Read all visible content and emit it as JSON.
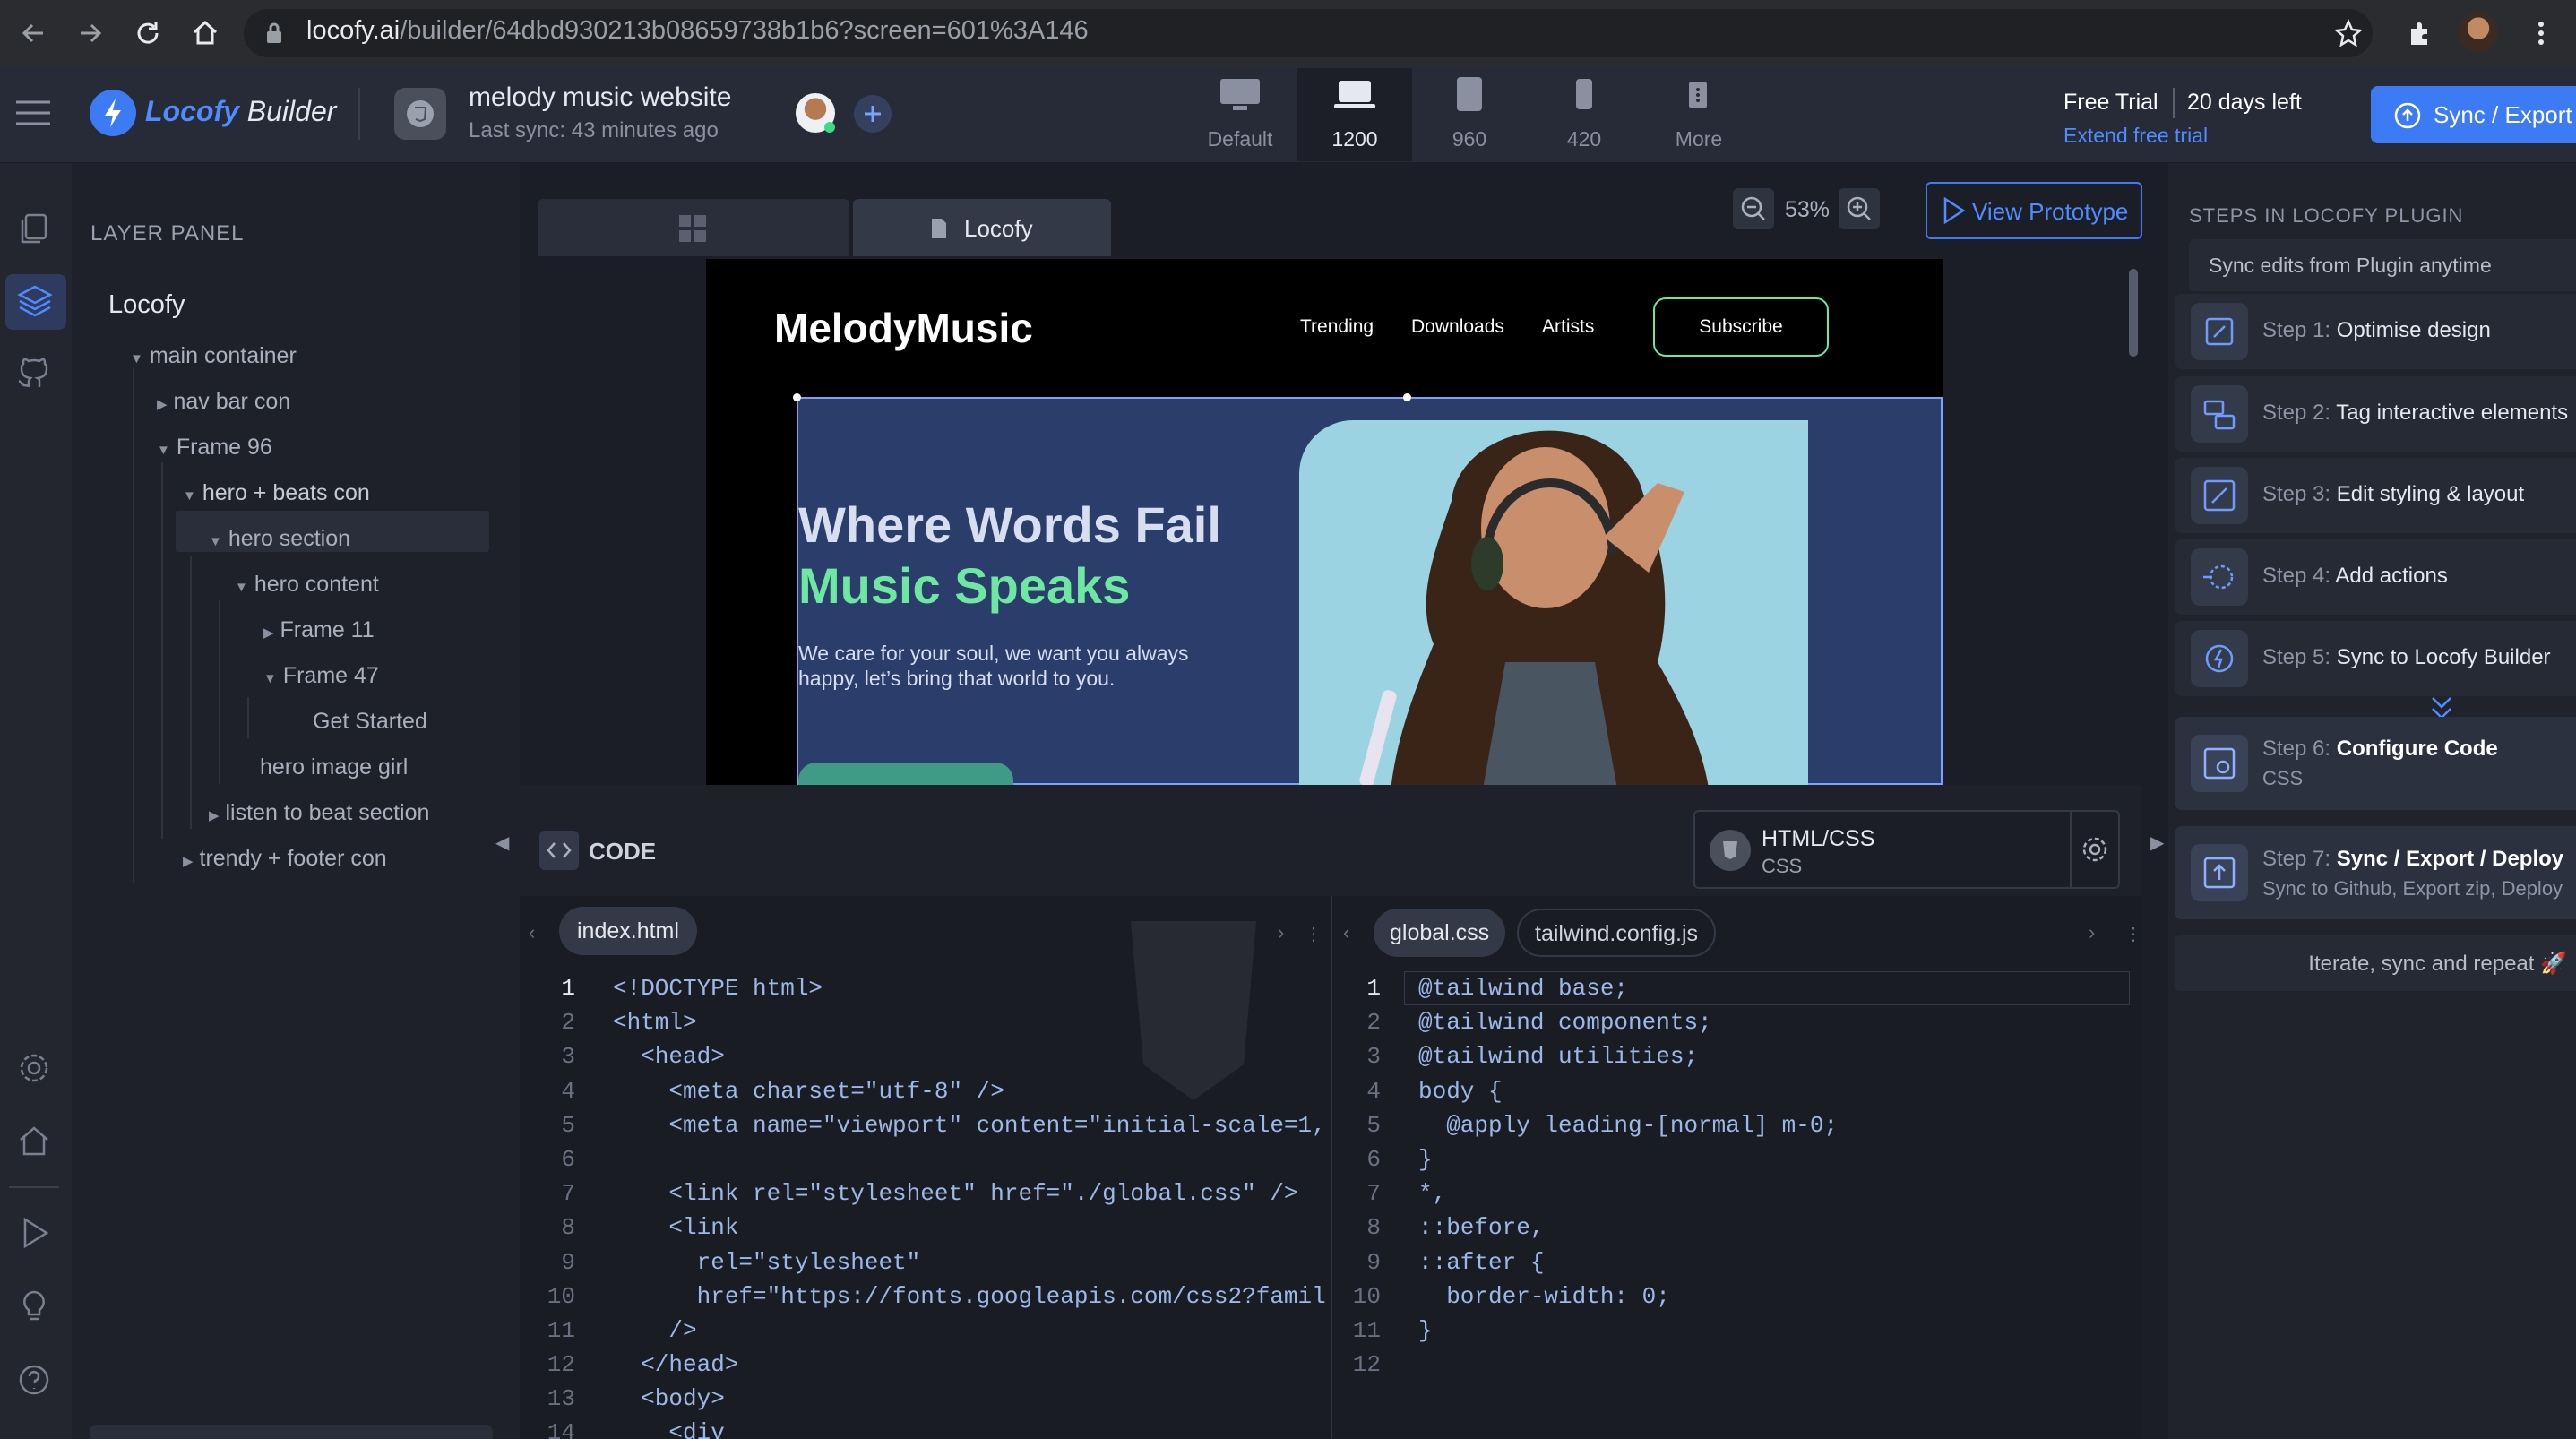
{
  "browser": {
    "url_host": "locofy.ai",
    "url_path": "/builder/64dbd930213b08659738b1b6?screen=601%3A146"
  },
  "header": {
    "brand": "Locofy",
    "brand_suffix": "Builder",
    "project_name": "melody music website",
    "last_sync": "Last sync: 43 minutes ago",
    "breakpoints": [
      {
        "label": "Default"
      },
      {
        "label": "1200"
      },
      {
        "label": "960"
      },
      {
        "label": "420"
      },
      {
        "label": "More"
      }
    ],
    "active_breakpoint": "1200",
    "trial_label": "Free Trial",
    "trial_days": "20 days left",
    "extend_link": "Extend free trial",
    "sync_button": "Sync / Export"
  },
  "layer_panel": {
    "title": "LAYER PANEL",
    "root": "Locofy",
    "items": [
      {
        "label": "main container"
      },
      {
        "label": "nav bar con"
      },
      {
        "label": "Frame 96"
      },
      {
        "label": "hero + beats con"
      },
      {
        "label": "hero section"
      },
      {
        "label": "hero content"
      },
      {
        "label": "Frame 11"
      },
      {
        "label": "Frame 47"
      },
      {
        "label": "Get Started"
      },
      {
        "label": "hero image girl"
      },
      {
        "label": "listen to beat section"
      },
      {
        "label": "trendy + footer con"
      }
    ]
  },
  "canvas": {
    "tab_label": "Locofy",
    "zoom": "53%",
    "view_prototype": "View Prototype",
    "preview": {
      "logo": "MelodyMusic",
      "nav": [
        "Trending",
        "Downloads",
        "Artists"
      ],
      "subscribe": "Subscribe",
      "headline_1": "Where Words Fail",
      "headline_2": "Music Speaks",
      "body": "We care for your soul, we want you always happy, let’s bring that world to you."
    }
  },
  "code_panel": {
    "title": "CODE",
    "framework": "HTML/CSS",
    "framework_sub": "CSS",
    "left_tab": "index.html",
    "right_tabs": [
      "global.css",
      "tailwind.config.js"
    ],
    "html_lines": [
      "<!DOCTYPE html>",
      "<html>",
      "  <head>",
      "    <meta charset=\"utf-8\" />",
      "    <meta name=\"viewport\" content=\"initial-scale=1,",
      "",
      "    <link rel=\"stylesheet\" href=\"./global.css\" />",
      "    <link",
      "      rel=\"stylesheet\"",
      "      href=\"https://fonts.googleapis.com/css2?famil",
      "    />",
      "  </head>",
      "  <body>",
      "    <div"
    ],
    "css_lines": [
      "@tailwind base;",
      "@tailwind components;",
      "@tailwind utilities;",
      "body {",
      "  @apply leading-[normal] m-0;",
      "}",
      "*,",
      "::before,",
      "::after {",
      "  border-width: 0;",
      "}",
      ""
    ]
  },
  "steps_panel": {
    "title": "STEPS IN LOCOFY PLUGIN",
    "subtitle": "Sync edits from Plugin anytime",
    "steps": [
      {
        "num": "Step 1:",
        "label": "Optimise design",
        "sub": ""
      },
      {
        "num": "Step 2:",
        "label": "Tag interactive elements",
        "sub": ""
      },
      {
        "num": "Step 3:",
        "label": "Edit styling & layout",
        "sub": ""
      },
      {
        "num": "Step 4:",
        "label": "Add actions",
        "sub": ""
      },
      {
        "num": "Step 5:",
        "label": "Sync to Locofy Builder",
        "sub": ""
      },
      {
        "num": "Step 6:",
        "label": "Configure Code",
        "sub": "CSS"
      },
      {
        "num": "Step 7:",
        "label": "Sync / Export / Deploy",
        "sub": "Sync to Github, Export zip, Deploy"
      }
    ],
    "footer": "Iterate, sync and repeat 🚀"
  },
  "colors": {
    "accent": "#3d7bf5",
    "brand": "#4e8cff",
    "green": "#6ee7a0",
    "hero_bg": "#2a3d6b"
  }
}
